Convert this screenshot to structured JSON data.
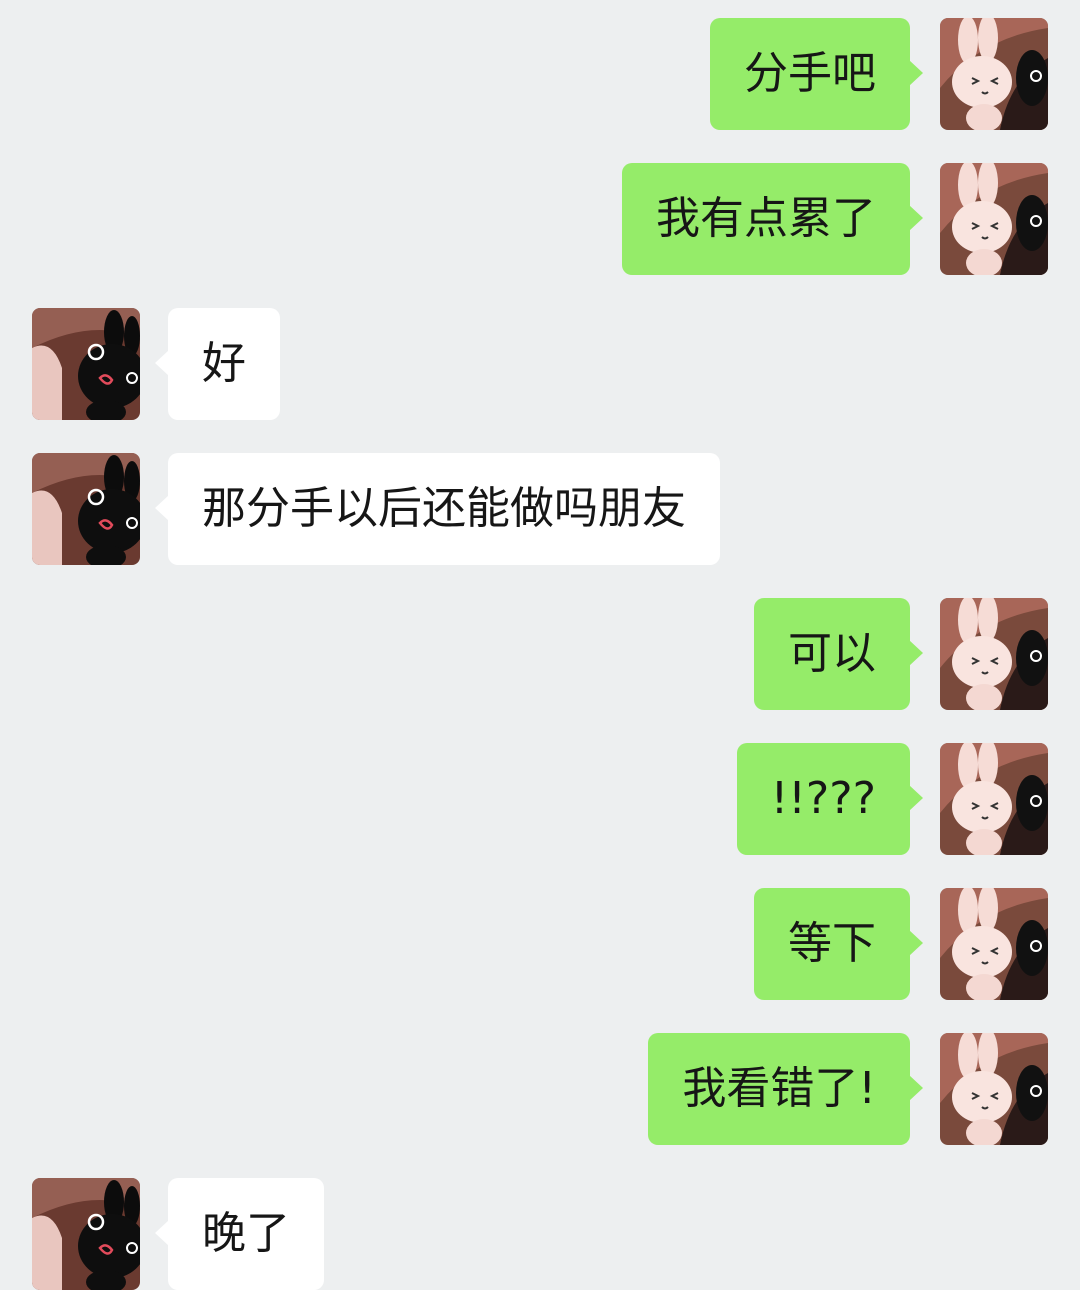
{
  "conversation": {
    "messages": [
      {
        "side": "right",
        "text": "分手吧",
        "avatar": "white-bunny-avatar"
      },
      {
        "side": "right",
        "text": "我有点累了",
        "avatar": "white-bunny-avatar"
      },
      {
        "side": "left",
        "text": "好",
        "avatar": "black-bunny-avatar"
      },
      {
        "side": "left",
        "text": "那分手以后还能做吗朋友",
        "avatar": "black-bunny-avatar"
      },
      {
        "side": "right",
        "text": "可以",
        "avatar": "white-bunny-avatar"
      },
      {
        "side": "right",
        "text": "!!???",
        "avatar": "white-bunny-avatar"
      },
      {
        "side": "right",
        "text": "等下",
        "avatar": "white-bunny-avatar"
      },
      {
        "side": "right",
        "text": "我看错了!",
        "avatar": "white-bunny-avatar"
      },
      {
        "side": "left",
        "text": "晚了",
        "avatar": "black-bunny-avatar"
      }
    ]
  },
  "colors": {
    "background": "#edeff0",
    "outgoing_bubble": "#95ec69",
    "incoming_bubble": "#ffffff"
  }
}
